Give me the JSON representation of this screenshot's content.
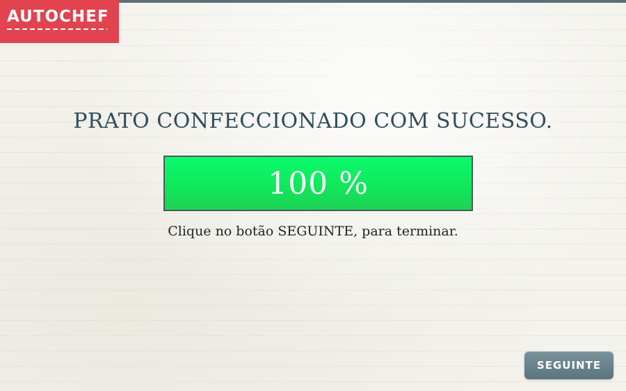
{
  "logo": {
    "text": "AUTOCHEF",
    "background_color": "#e1444f"
  },
  "main": {
    "title": "PRATO CONFECCIONADO COM SUCESSO.",
    "progress": {
      "label": "100 %",
      "value_percent": 100,
      "fill_color": "#10e85c"
    },
    "instruction": "Clique no botão SEGUINTE, para terminar."
  },
  "footer": {
    "next_button_label": "SEGUINTE"
  },
  "colors": {
    "title_text": "#2f4d5a",
    "button": "#6a838c",
    "top_strip": "#5c6f77"
  }
}
